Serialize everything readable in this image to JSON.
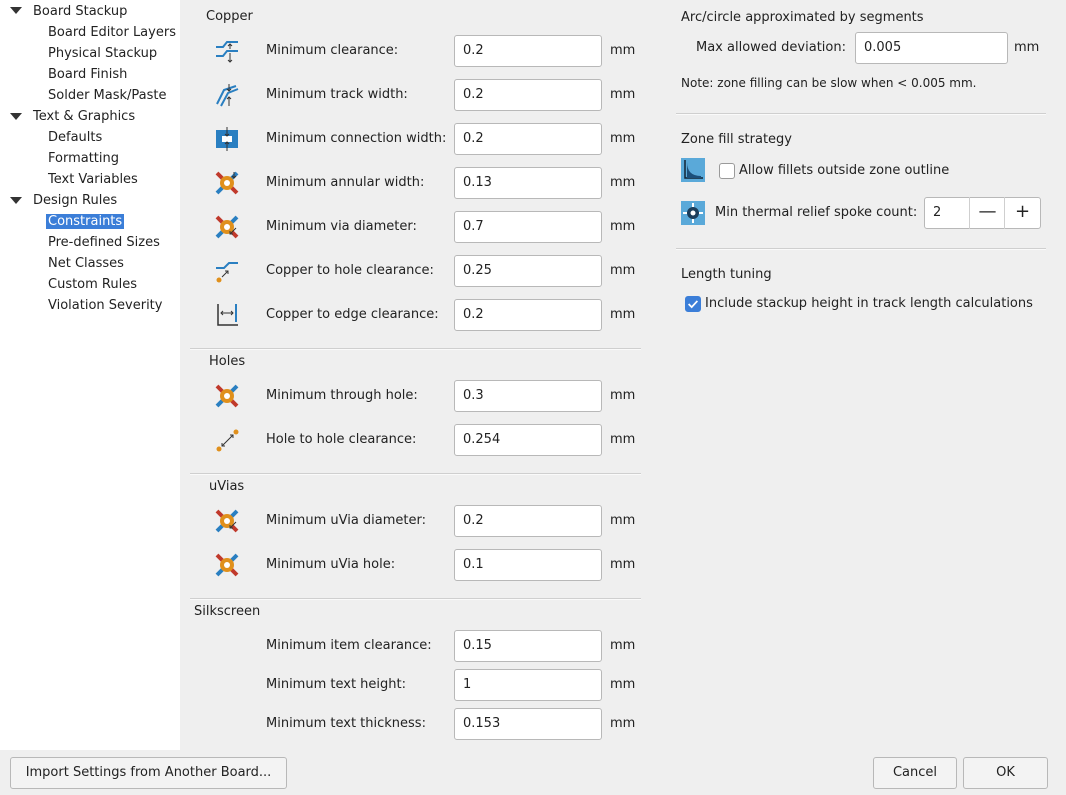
{
  "tree": {
    "items": [
      {
        "label": "Board Stackup",
        "level": 0,
        "expanded": true
      },
      {
        "label": "Board Editor Layers",
        "level": 1
      },
      {
        "label": "Physical Stackup",
        "level": 1
      },
      {
        "label": "Board Finish",
        "level": 1
      },
      {
        "label": "Solder Mask/Paste",
        "level": 1
      },
      {
        "label": "Text & Graphics",
        "level": 0,
        "expanded": true
      },
      {
        "label": "Defaults",
        "level": 1
      },
      {
        "label": "Formatting",
        "level": 1
      },
      {
        "label": "Text Variables",
        "level": 1
      },
      {
        "label": "Design Rules",
        "level": 0,
        "expanded": true
      },
      {
        "label": "Constraints",
        "level": 1,
        "selected": true
      },
      {
        "label": "Pre-defined Sizes",
        "level": 1
      },
      {
        "label": "Net Classes",
        "level": 1
      },
      {
        "label": "Custom Rules",
        "level": 1
      },
      {
        "label": "Violation Severity",
        "level": 1
      }
    ]
  },
  "sections": {
    "copper": "Copper",
    "holes": "Holes",
    "uvias": "uVias",
    "silkscreen": "Silkscreen"
  },
  "unit": "mm",
  "rows": {
    "min_clearance": {
      "label": "Minimum clearance:",
      "value": "0.2"
    },
    "min_track_width": {
      "label": "Minimum track width:",
      "value": "0.2"
    },
    "min_connection_width": {
      "label": "Minimum connection width:",
      "value": "0.2"
    },
    "min_annular_width": {
      "label": "Minimum annular width:",
      "value": "0.13"
    },
    "min_via_diameter": {
      "label": "Minimum via diameter:",
      "value": "0.7"
    },
    "copper_hole_clearance": {
      "label": "Copper to hole clearance:",
      "value": "0.25"
    },
    "copper_edge_clearance": {
      "label": "Copper to edge clearance:",
      "value": "0.2"
    },
    "min_through_hole": {
      "label": "Minimum through hole:",
      "value": "0.3"
    },
    "hole_hole_clearance": {
      "label": "Hole to hole clearance:",
      "value": "0.254"
    },
    "min_uvia_diameter": {
      "label": "Minimum uVia diameter:",
      "value": "0.2"
    },
    "min_uvia_hole": {
      "label": "Minimum uVia hole:",
      "value": "0.1"
    },
    "min_item_clearance": {
      "label": "Minimum item clearance:",
      "value": "0.15"
    },
    "min_text_height": {
      "label": "Minimum text height:",
      "value": "1"
    },
    "min_text_thickness": {
      "label": "Minimum text thickness:",
      "value": "0.153"
    }
  },
  "arc": {
    "title": "Arc/circle approximated by segments",
    "deviation_label": "Max allowed deviation:",
    "deviation_value": "0.005",
    "note": "Note: zone filling can be slow when < 0.005 mm."
  },
  "zone": {
    "title": "Zone fill strategy",
    "fillets_label": "Allow fillets outside zone outline",
    "fillets_checked": false,
    "spoke_label": "Min thermal relief spoke count:",
    "spoke_value": "2",
    "minus": "—",
    "plus": "+"
  },
  "length": {
    "title": "Length tuning",
    "stackup_label": "Include stackup height in track length calculations",
    "stackup_checked": true
  },
  "footer": {
    "import_label": "Import Settings from Another Board...",
    "cancel_label": "Cancel",
    "ok_label": "OK"
  },
  "colors": {
    "accent": "#3b7ed8",
    "icon_blue": "#2a7fc1",
    "icon_orange": "#e0901c",
    "icon_red": "#c0392b"
  }
}
